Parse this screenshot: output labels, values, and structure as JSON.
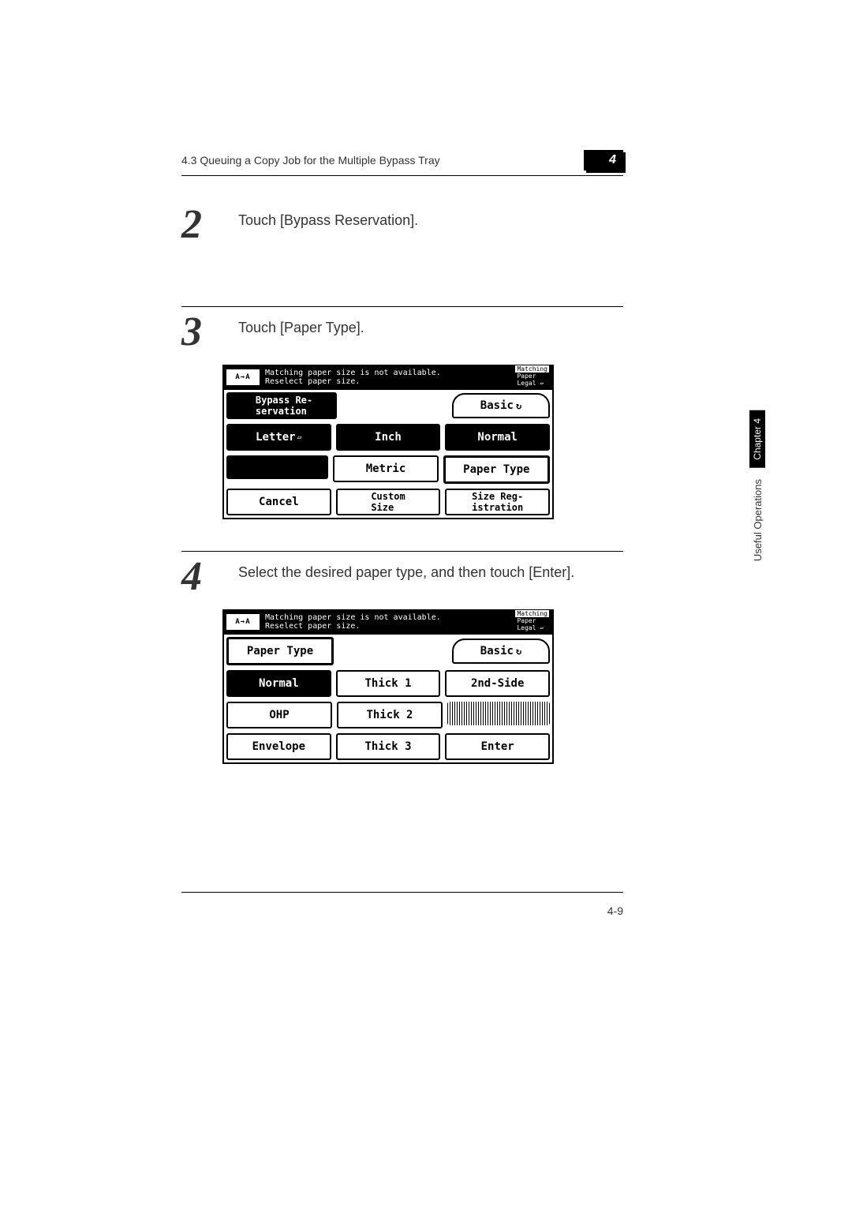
{
  "header": {
    "section": "4.3 Queuing a Copy Job for the Multiple Bypass Tray",
    "chapter_num": "4"
  },
  "steps": {
    "s2": {
      "num": "2",
      "text": "Touch [Bypass Reservation]."
    },
    "s3": {
      "num": "3",
      "text": "Touch [Paper Type]."
    },
    "s4": {
      "num": "4",
      "text": "Select the desired paper type, and then touch [Enter]."
    }
  },
  "screen3": {
    "msg": "Matching paper size is not available.\nReselect paper size.",
    "corner": "A→A",
    "match1": "Matching",
    "match2": "Paper",
    "match3": "Legal ▱",
    "title": "Bypass Re-\nservation",
    "basic": "Basic",
    "letter": "Letter",
    "inch": "Inch",
    "normal": "Normal",
    "metric": "Metric",
    "paper_type": "Paper Type",
    "cancel": "Cancel",
    "custom_size": "Custom\nSize",
    "size_reg": "Size Reg-\nistration"
  },
  "screen4": {
    "msg": "Matching paper size is not available.\nReselect paper size.",
    "corner": "A→A",
    "match1": "Matching",
    "match2": "Paper",
    "match3": "Legal ▱",
    "title": "Paper Type",
    "basic": "Basic",
    "normal": "Normal",
    "thick1": "Thick 1",
    "second_side": "2nd-Side",
    "ohp": "OHP",
    "thick2": "Thick 2",
    "envelope": "Envelope",
    "thick3": "Thick 3",
    "enter": "Enter"
  },
  "side": {
    "label": "Useful Operations",
    "chapter": "Chapter 4"
  },
  "page_number": "4-9"
}
